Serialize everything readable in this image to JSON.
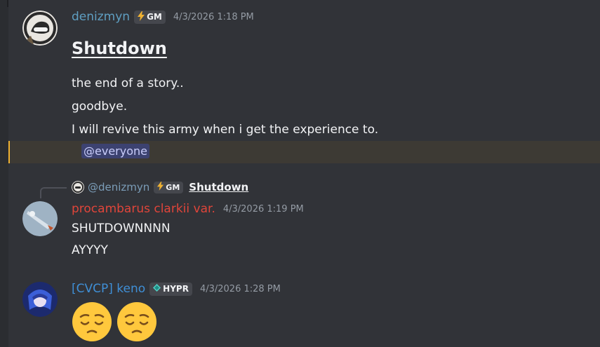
{
  "messages": [
    {
      "author": "denizmyn",
      "author_color": "#5f9fc2",
      "tag": {
        "icon": "lightning-icon",
        "label": "GM"
      },
      "timestamp": "4/3/2026 1:18 PM",
      "heading": "Shutdown",
      "lines": [
        "the end of a story..",
        "goodbye.",
        "I will revive this army when i get the experience to."
      ],
      "mention": "@everyone"
    },
    {
      "reply": {
        "author": "@denizmyn",
        "tag": {
          "icon": "lightning-icon",
          "label": "GM"
        },
        "text": "Shutdown"
      },
      "author": "procambarus clarkii var.",
      "author_color": "#e0453a",
      "timestamp": "4/3/2026 1:19 PM",
      "lines": [
        "SHUTDOWNNNN",
        "AYYYY"
      ]
    },
    {
      "author": "[CVCP] keno",
      "author_color": "#3f8fd6",
      "tag": {
        "icon": "diamond-icon",
        "label": "HYPR"
      },
      "timestamp": "4/3/2026 1:28 PM",
      "emojis": [
        "pensive-emoji",
        "pensive-emoji"
      ]
    }
  ]
}
